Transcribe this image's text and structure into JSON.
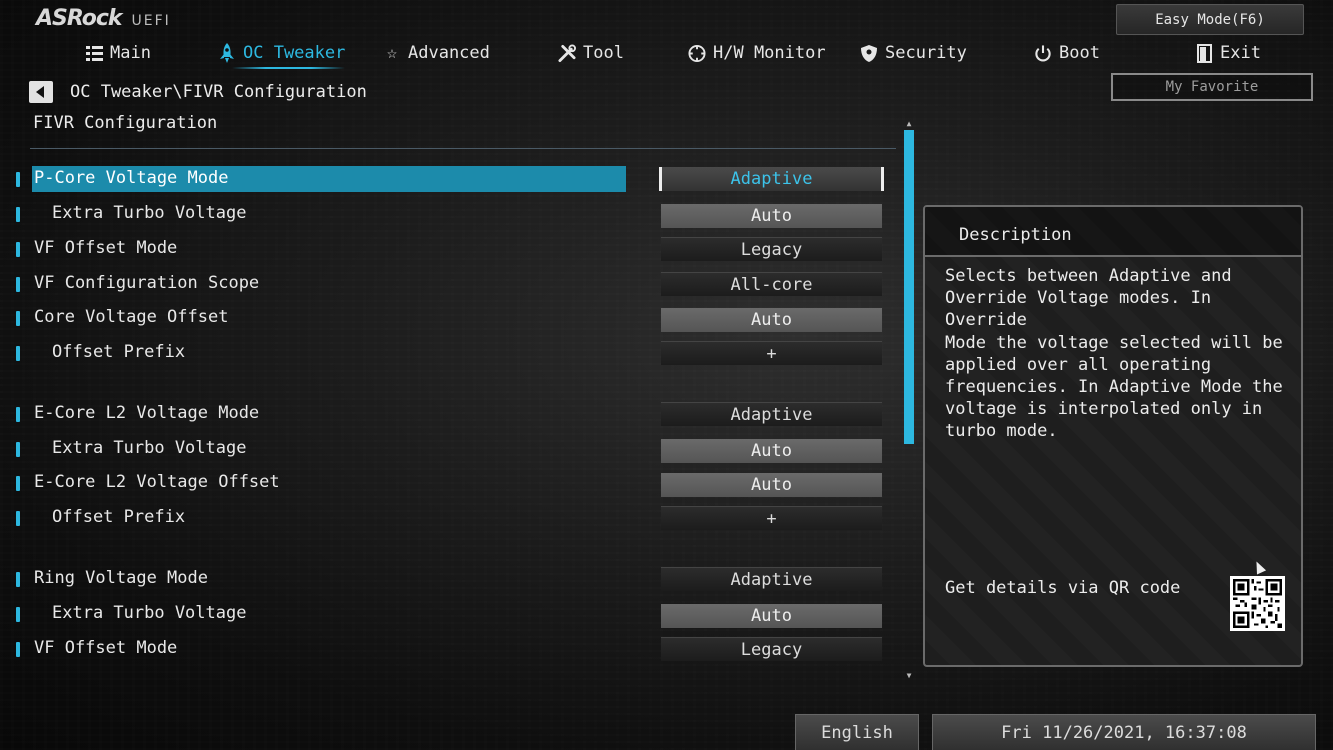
{
  "brand": {
    "name": "ASRock",
    "sub": "UEFI"
  },
  "easy_mode_label": "Easy Mode(F6)",
  "nav": [
    {
      "label": "Main",
      "icon": "list-icon",
      "active": false
    },
    {
      "label": "OC Tweaker",
      "icon": "rocket-icon",
      "active": true
    },
    {
      "label": "Advanced",
      "icon": "star-icon",
      "active": false
    },
    {
      "label": "Tool",
      "icon": "tools-icon",
      "active": false
    },
    {
      "label": "H/W Monitor",
      "icon": "monitor-icon",
      "active": false
    },
    {
      "label": "Security",
      "icon": "shield-icon",
      "active": false
    },
    {
      "label": "Boot",
      "icon": "power-icon",
      "active": false
    },
    {
      "label": "Exit",
      "icon": "exit-icon",
      "active": false
    }
  ],
  "my_favorite_label": "My Favorite",
  "breadcrumb": "OC Tweaker\\FIVR Configuration",
  "section_title": "FIVR Configuration",
  "settings": [
    {
      "label": "P-Core Voltage Mode",
      "value": "Adaptive",
      "selected": true
    },
    {
      "label": "Extra Turbo Voltage",
      "value": "Auto"
    },
    {
      "label": "VF Offset Mode",
      "value": "Legacy"
    },
    {
      "label": "VF Configuration Scope",
      "value": "All-core"
    },
    {
      "label": "Core Voltage Offset",
      "value": "Auto"
    },
    {
      "label": "Offset Prefix",
      "value": "+"
    },
    {
      "label": "E-Core L2 Voltage Mode",
      "value": "Adaptive"
    },
    {
      "label": "Extra Turbo Voltage",
      "value": "Auto"
    },
    {
      "label": "E-Core L2 Voltage Offset",
      "value": "Auto"
    },
    {
      "label": "Offset Prefix",
      "value": "+"
    },
    {
      "label": "Ring Voltage Mode",
      "value": "Adaptive"
    },
    {
      "label": "Extra Turbo Voltage",
      "value": "Auto"
    },
    {
      "label": "VF Offset Mode",
      "value": "Legacy"
    }
  ],
  "description": {
    "title": "Description",
    "text": "Selects between Adaptive and\nOverride Voltage modes. In Override\nMode the voltage selected will be\napplied over all operating\nfrequencies. In Adaptive Mode the\nvoltage is interpolated only in\nturbo mode.",
    "qr_label": "Get details via QR code"
  },
  "footer": {
    "language": "English",
    "datetime": "Fri 11/26/2021, 16:37:08"
  },
  "colors": {
    "accent": "#2db8e0",
    "selection": "#1c8bab"
  }
}
